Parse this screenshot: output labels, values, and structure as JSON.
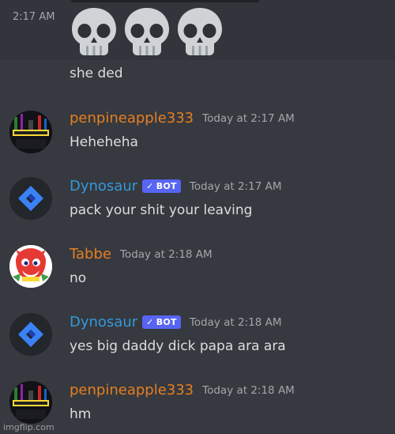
{
  "first_message": {
    "timestamp": "2:17 AM",
    "emojis": [
      "skull-emoji",
      "skull-emoji",
      "skull-emoji"
    ],
    "text": "she ded"
  },
  "messages": [
    {
      "username": "penpineapple333",
      "username_color": "#e67e22",
      "is_bot": false,
      "timestamp": "Today at 2:17 AM",
      "text": "Heheheha",
      "avatar": "penpineapple-avatar"
    },
    {
      "username": "Dynosaur",
      "username_color": "#3498db",
      "is_bot": true,
      "bot_label": "BOT",
      "timestamp": "Today at 2:17 AM",
      "text": "pack your shit your leaving",
      "avatar": "dynosaur-avatar"
    },
    {
      "username": "Tabbe",
      "username_color": "#e67e22",
      "is_bot": false,
      "timestamp": "Today at 2:18 AM",
      "text": "no",
      "avatar": "tabbe-avatar"
    },
    {
      "username": "Dynosaur",
      "username_color": "#3498db",
      "is_bot": true,
      "bot_label": "BOT",
      "timestamp": "Today at 2:18 AM",
      "text": "yes big daddy dick papa ara ara",
      "avatar": "dynosaur-avatar"
    },
    {
      "username": "penpineapple333",
      "username_color": "#e67e22",
      "is_bot": false,
      "timestamp": "Today at 2:18 AM",
      "text": "hm",
      "avatar": "penpineapple-avatar"
    }
  ],
  "watermark": "imgflip.com",
  "colors": {
    "background": "#36393f",
    "text": "#dcddde",
    "timestamp": "#a3a6aa",
    "bot_tag": "#5865f2"
  }
}
